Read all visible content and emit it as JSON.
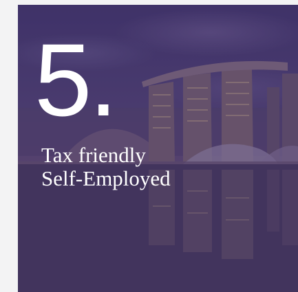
{
  "card": {
    "number": "5.",
    "title_line1": "Tax friendly",
    "title_line2": "Self-Employed"
  },
  "colors": {
    "page_background": "#f3f3f4",
    "overlay_purple": "#4a3c6f",
    "text": "#ffffff"
  }
}
